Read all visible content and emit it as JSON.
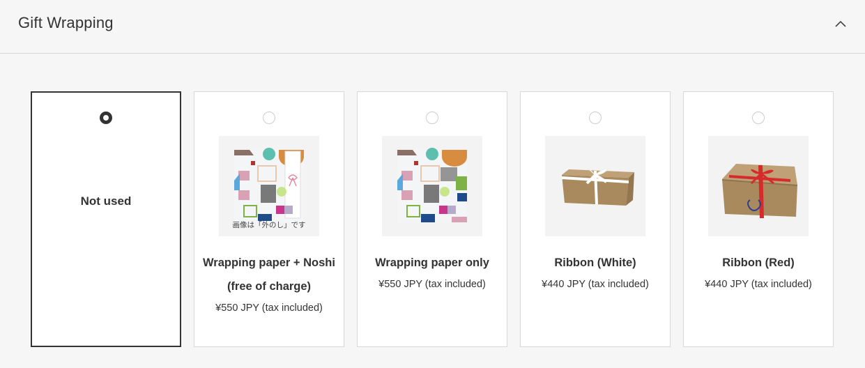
{
  "section": {
    "title": "Gift Wrapping",
    "collapse_icon": "chevron-up-icon",
    "expanded": true
  },
  "options": [
    {
      "id": "not-used",
      "label": "Not used",
      "selected": true
    },
    {
      "id": "wrapping-paper-noshi",
      "name_line1": "Wrapping paper + Noshi",
      "name_line2": "(free of charge)",
      "price": "¥550 JPY (tax included)",
      "image_caption": "画像は「外のし」です",
      "image": "wrapping-paper-with-noshi-image",
      "selected": false
    },
    {
      "id": "wrapping-paper-only",
      "name": "Wrapping paper only",
      "price": "¥550 JPY (tax included)",
      "image": "wrapping-paper-image",
      "selected": false
    },
    {
      "id": "ribbon-white",
      "name": "Ribbon (White)",
      "price": "¥440 JPY (tax included)",
      "image": "white-ribbon-box-image",
      "selected": false
    },
    {
      "id": "ribbon-red",
      "name": "Ribbon (Red)",
      "price": "¥440 JPY (tax included)",
      "image": "red-ribbon-box-image",
      "selected": false
    }
  ],
  "colors": {
    "selected_border": "#333333",
    "card_border": "#d8d8d8",
    "background": "#f6f6f6",
    "ribbon_white": "#ffffff",
    "ribbon_red": "#d62b2b",
    "box_kraft": "#a88a5e"
  }
}
